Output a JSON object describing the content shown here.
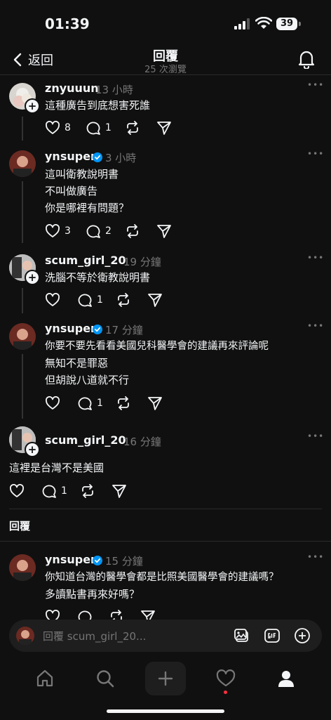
{
  "status_bar": {
    "time": "01:39",
    "battery": "39"
  },
  "header": {
    "back_label": "返回",
    "title": "回覆",
    "views": "25 次瀏覽"
  },
  "posts": [
    {
      "username": "znyuuun",
      "time": "13 小時",
      "lines": [
        "這種廣告到底想害死誰"
      ],
      "likes": "8",
      "replies": "1",
      "verified": false
    },
    {
      "username": "ynsuper",
      "time": "3 小時",
      "lines": [
        "這叫衛教說明書",
        "不叫做廣告",
        "你是哪裡有問題？"
      ],
      "likes": "3",
      "replies": "2",
      "verified": true
    },
    {
      "username": "scum_girl_20",
      "time": "19 分鐘",
      "lines": [
        "洗腦不等於衛教說明書"
      ],
      "likes": "",
      "replies": "1",
      "verified": false
    },
    {
      "username": "ynsuper",
      "time": "17 分鐘",
      "lines": [
        "你要不要先看看美國兒科醫學會的建議再來評論呢",
        "無知不是罪惡",
        "但胡說八道就不行"
      ],
      "likes": "",
      "replies": "1",
      "verified": true
    },
    {
      "username": "scum_girl_20",
      "time": "16 分鐘",
      "lines": [
        "這裡是台灣不是美國"
      ],
      "likes": "",
      "replies": "1",
      "verified": false
    }
  ],
  "replies_section": {
    "label": "回覆"
  },
  "reply_post": {
    "username": "ynsuper",
    "time": "15 分鐘",
    "lines": [
      "你知道台灣的醫學會都是比照美國醫學會的建議嗎？",
      "多讀點書再來好嗎？"
    ],
    "verified": true
  },
  "composer": {
    "placeholder": "回覆 scum_girl_20..."
  },
  "more_label": "•••",
  "plus_label": "+",
  "colors": {
    "background": "#101010",
    "text": "#f3f5f7",
    "muted": "#777777",
    "verified": "#0095f6",
    "notify_dot": "#ff3040"
  }
}
